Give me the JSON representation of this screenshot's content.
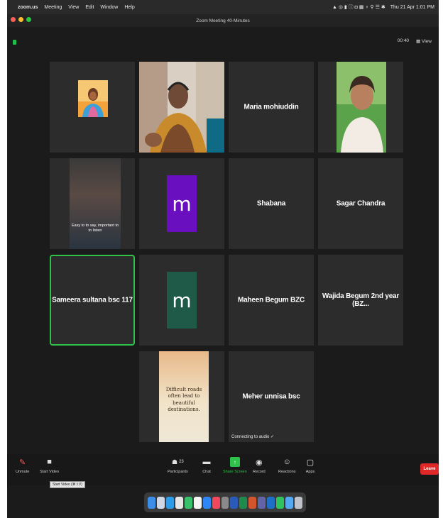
{
  "menubar": {
    "app": "zoom.us",
    "items": [
      "Meeting",
      "View",
      "Edit",
      "Window",
      "Help"
    ],
    "clock": "Thu 21 Apr 1:01 PM"
  },
  "titlebar": {
    "title": "Zoom Meeting  40-Minutes"
  },
  "topright": {
    "timer": "00:40",
    "view": "View"
  },
  "tiles": {
    "maria": "Maria mohiuddin",
    "shabana": "Shabana",
    "sagar": "Sagar Chandra",
    "sameera": "Sameera sultana bsc 117",
    "maheen": "Maheen Begum BZC",
    "wajida": "Wajida Begum 2nd year (BZ...",
    "meher": "Meher unnisa bsc",
    "connecting": "Connecting to audio",
    "quote_small": "Easy to to say, important to to listen",
    "quote_big": "Difficult roads often lead to beautiful destinations.",
    "avatar_letter": "m"
  },
  "toolbar": {
    "unmute": "Unmute",
    "start_video": "Start Video",
    "participants": "Participants",
    "participants_count": "23",
    "chat": "Chat",
    "share_screen": "Share Screen",
    "record": "Record",
    "reactions": "Reactions",
    "apps": "Apps",
    "leave": "Leave",
    "tooltip": "Start Video (⌘⇧V)"
  },
  "colors": {
    "accent_green": "#2ec24a",
    "leave_red": "#e02828",
    "purple_avatar": "#6a0fbf",
    "teal_avatar": "#1f5a48"
  }
}
